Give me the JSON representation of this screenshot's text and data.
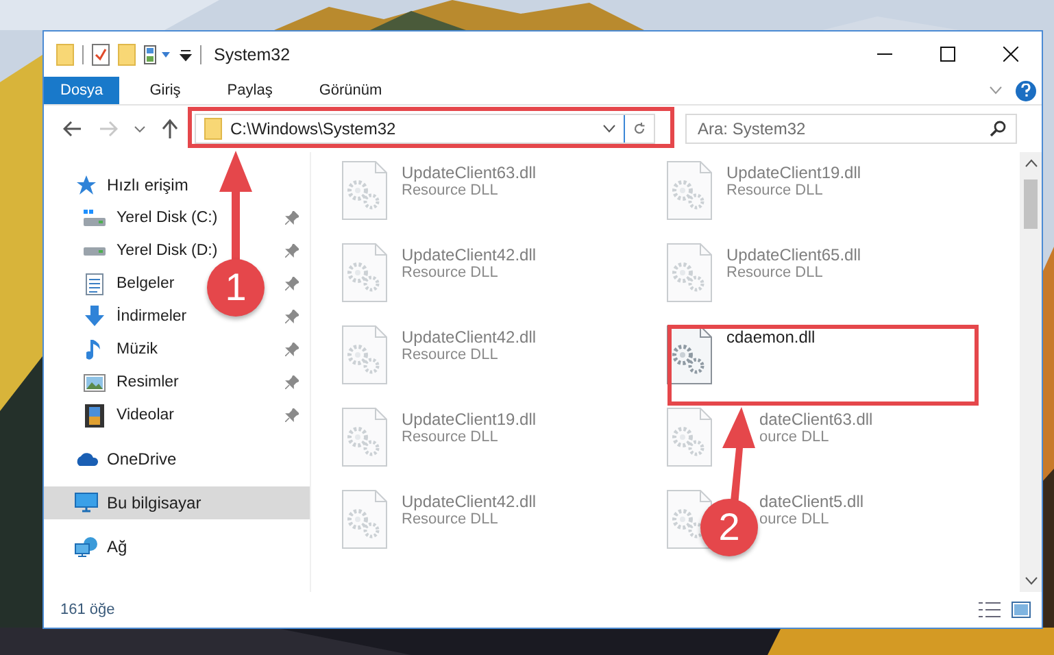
{
  "window": {
    "title": "System32"
  },
  "ribbon": {
    "tabs": [
      {
        "label": "Dosya",
        "selected": true
      },
      {
        "label": "Giriş",
        "selected": false
      },
      {
        "label": "Paylaş",
        "selected": false
      },
      {
        "label": "Görünüm",
        "selected": false
      }
    ]
  },
  "address_bar": {
    "path": "C:\\Windows\\System32"
  },
  "search": {
    "placeholder": "Ara: System32"
  },
  "sidebar": {
    "items": [
      {
        "label": "Hızlı erişim",
        "selected": false,
        "children": [
          {
            "label": "Yerel Disk (C:)",
            "pinned": true,
            "selected": false
          },
          {
            "label": "Yerel Disk (D:)",
            "pinned": true,
            "selected": false
          },
          {
            "label": "Belgeler",
            "pinned": true,
            "selected": false
          },
          {
            "label": "İndirmeler",
            "pinned": true,
            "selected": false
          },
          {
            "label": "Müzik",
            "pinned": true,
            "selected": false
          },
          {
            "label": "Resimler",
            "pinned": true,
            "selected": false
          },
          {
            "label": "Videolar",
            "pinned": true,
            "selected": false
          }
        ]
      },
      {
        "label": "OneDrive",
        "selected": false
      },
      {
        "label": "Bu bilgisayar",
        "selected": true
      },
      {
        "label": "Ağ",
        "selected": false
      }
    ]
  },
  "files": [
    {
      "kind": "full",
      "name": "UpdateClient63.dll",
      "type": "Resource DLL",
      "blurred": true
    },
    {
      "kind": "full",
      "name": "UpdateClient19.dll",
      "type": "Resource DLL",
      "blurred": true
    },
    {
      "kind": "full",
      "name": "UpdateClient42.dll",
      "type": "Resource DLL",
      "blurred": true
    },
    {
      "kind": "full",
      "name": "UpdateClient65.dll",
      "type": "Resource DLL",
      "blurred": true
    },
    {
      "kind": "full",
      "name": "UpdateClient42.dll",
      "type": "Resource DLL",
      "blurred": true
    },
    {
      "kind": "full",
      "name": "cdaemon.dll",
      "blurred": false
    },
    {
      "kind": "full",
      "name": "UpdateClient19.dll",
      "type": "Resource DLL",
      "blurred": true
    },
    {
      "kind": "covered",
      "name": "dateClient63.dll",
      "type": "ource DLL",
      "blurred": true
    },
    {
      "kind": "full",
      "name": "UpdateClient42.dll",
      "type": "Resource DLL",
      "blurred": true
    },
    {
      "kind": "covered",
      "name": "dateClient5.dll",
      "type": "ource DLL",
      "blurred": true
    }
  ],
  "status_bar": {
    "item_count": "161 öğe"
  },
  "annotations": [
    {
      "label": "1"
    },
    {
      "label": "2"
    }
  ]
}
